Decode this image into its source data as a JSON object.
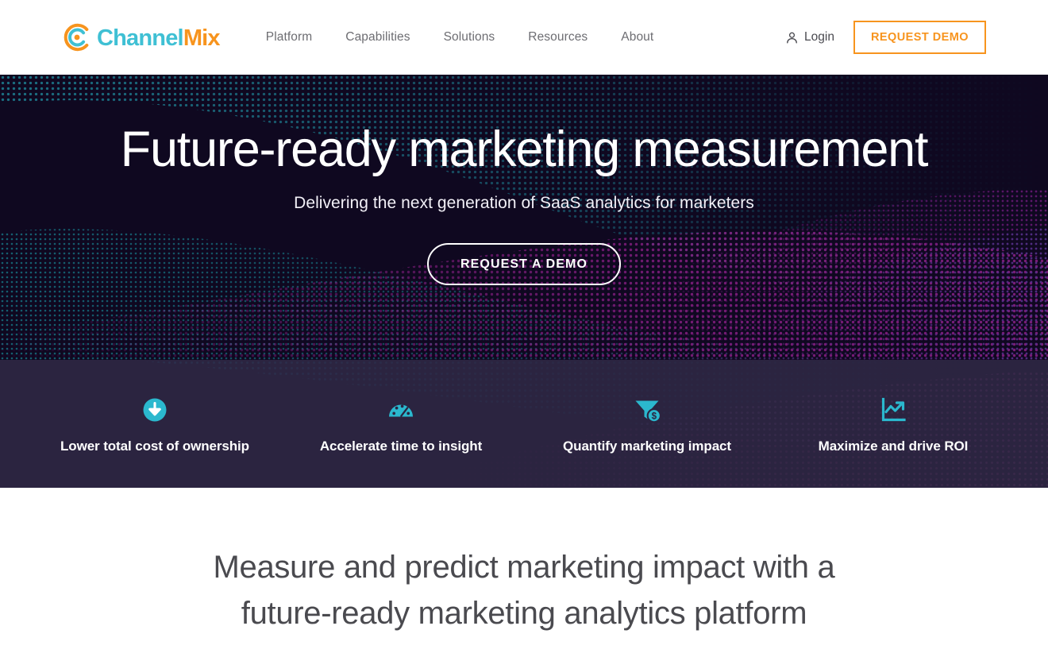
{
  "brand": {
    "logo_icon": "channelmix-circle-logo",
    "name_part1": "Channel",
    "name_part2": "Mix",
    "teal": "#3FC0D4",
    "orange": "#F7941E"
  },
  "header": {
    "nav": [
      {
        "label": "Platform"
      },
      {
        "label": "Capabilities"
      },
      {
        "label": "Solutions"
      },
      {
        "label": "Resources"
      },
      {
        "label": "About"
      }
    ],
    "login": {
      "icon": "user-icon",
      "label": "Login"
    },
    "demo_button": {
      "label": "REQUEST DEMO"
    }
  },
  "hero": {
    "title": "Future-ready marketing measurement",
    "subtitle": "Delivering the next generation of SaaS analytics for marketers",
    "cta": {
      "label": "REQUEST A DEMO"
    },
    "background": "dotted-wave-mesh",
    "bg_color": "#0f0820",
    "wave_teal": "#19707f",
    "wave_purple": "#8e1f86"
  },
  "features": {
    "band_color": "#2b2440",
    "icon_color": "#2BB8CE",
    "items": [
      {
        "icon": "arrow-down-circle-icon",
        "label": "Lower total cost of ownership"
      },
      {
        "icon": "speedometer-icon",
        "label": "Accelerate time to insight"
      },
      {
        "icon": "funnel-dollar-icon",
        "label": "Quantify marketing impact"
      },
      {
        "icon": "chart-trending-up-icon",
        "label": "Maximize and drive ROI"
      }
    ]
  },
  "section": {
    "heading_line1": "Measure and predict marketing impact with a",
    "heading_line2": "future-ready marketing analytics platform",
    "heading_full": "Measure and predict marketing impact with a future-ready marketing analytics platform"
  }
}
